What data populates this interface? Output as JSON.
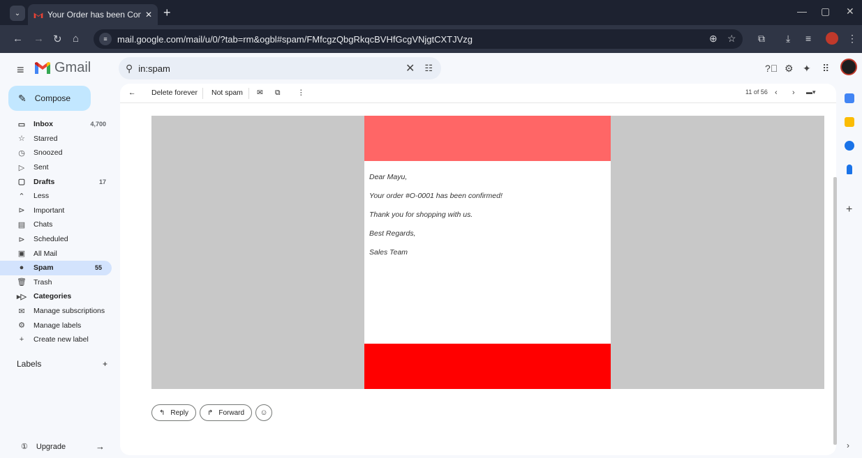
{
  "browser": {
    "tab_title": "Your Order has been Confirmed",
    "tab_close": "✕",
    "new_tab": "+",
    "url": "mail.google.com/mail/u/0/?tab=rm&ogbl#spam/FMfcgzQbgRkqcBVHfGcgVNjgtCXTJVzg",
    "window_controls": [
      "—",
      "▢",
      "✕"
    ]
  },
  "gmail": {
    "logo_text": "Gmail",
    "search_query": "in:spam",
    "compose_label": "Compose",
    "nav": [
      {
        "icon": "inbox-icon",
        "glyph": "▭",
        "label": "Inbox",
        "count": "4,700",
        "bold": true
      },
      {
        "icon": "star-icon",
        "glyph": "☆",
        "label": "Starred",
        "count": ""
      },
      {
        "icon": "clock-icon",
        "glyph": "◷",
        "label": "Snoozed",
        "count": ""
      },
      {
        "icon": "send-icon",
        "glyph": "▷",
        "label": "Sent",
        "count": ""
      },
      {
        "icon": "draft-icon",
        "glyph": "▢",
        "label": "Drafts",
        "count": "17",
        "bold": true
      },
      {
        "icon": "chevron-up-icon",
        "glyph": "⌃",
        "label": "Less",
        "count": ""
      },
      {
        "icon": "important-icon",
        "glyph": "⊳",
        "label": "Important",
        "count": ""
      },
      {
        "icon": "chat-icon",
        "glyph": "▤",
        "label": "Chats",
        "count": ""
      },
      {
        "icon": "scheduled-icon",
        "glyph": "⊳",
        "label": "Scheduled",
        "count": ""
      },
      {
        "icon": "all-mail-icon",
        "glyph": "▣",
        "label": "All Mail",
        "count": ""
      },
      {
        "icon": "spam-icon",
        "glyph": "●",
        "label": "Spam",
        "count": "55",
        "bold": true,
        "active": true
      },
      {
        "icon": "trash-icon",
        "glyph": "🗑",
        "label": "Trash",
        "count": ""
      },
      {
        "icon": "categories-icon",
        "glyph": "▸▷",
        "label": "Categories",
        "count": "",
        "bold": true
      },
      {
        "icon": "subscriptions-icon",
        "glyph": "✉",
        "label": "Manage subscriptions",
        "count": ""
      },
      {
        "icon": "gear-icon",
        "glyph": "⚙",
        "label": "Manage labels",
        "count": ""
      },
      {
        "icon": "plus-icon",
        "glyph": "+",
        "label": "Create new label",
        "count": ""
      }
    ],
    "labels_header": "Labels",
    "labels_add": "+",
    "upgrade_label": "Upgrade",
    "toolbar": {
      "delete_forever": "Delete forever",
      "not_spam": "Not spam",
      "pager": "11 of 56"
    },
    "email": {
      "lines": [
        "Dear Mayu,",
        "Your order #O-0001 has been confirmed!",
        "Thank you for shopping with us.",
        "Best Regards,",
        "Sales Team"
      ],
      "colors": {
        "banner_top": "#ff6666",
        "banner_bottom": "#ff0000",
        "canvas": "#c8c8c8"
      }
    },
    "reply_label": "Reply",
    "forward_label": "Forward"
  }
}
